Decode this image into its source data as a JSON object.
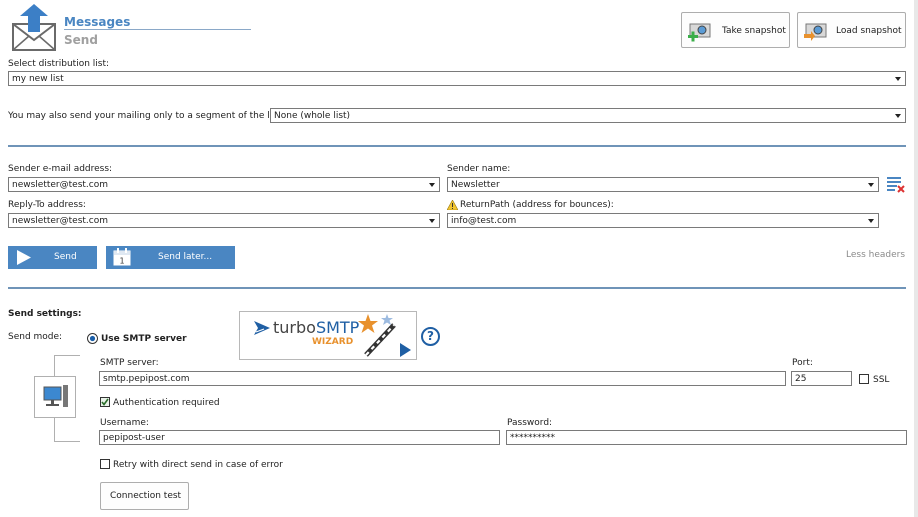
{
  "header": {
    "title": "Messages",
    "subtitle": "Send"
  },
  "toolbar": {
    "take_snapshot": "Take snapshot",
    "load_snapshot": "Load snapshot"
  },
  "distribution": {
    "label": "Select distribution list:",
    "value": "my new list"
  },
  "segment": {
    "label": "You may also send your mailing only to a segment of the list:",
    "value": "None (whole list)"
  },
  "sender": {
    "email_label": "Sender e-mail address:",
    "email_value": "newsletter@test.com",
    "name_label": "Sender name:",
    "name_value": "Newsletter",
    "replyto_label": "Reply-To address:",
    "replyto_value": "newsletter@test.com",
    "return_label": "ReturnPath (address for bounces):",
    "return_value": "info@test.com"
  },
  "actions": {
    "send": "Send",
    "send_later": "Send later...",
    "calendar_day": "1",
    "less_headers": "Less headers"
  },
  "settings": {
    "title": "Send settings:",
    "mode_label": "Send mode:",
    "mode_option": "Use SMTP server",
    "smtp_label": "SMTP server:",
    "smtp_value": "smtp.pepipost.com",
    "port_label": "Port:",
    "port_value": "25",
    "ssl_label": "SSL",
    "auth_label": "Authentication required",
    "username_label": "Username:",
    "username_value": "pepipost-user",
    "password_label": "Password:",
    "password_value": "**********",
    "retry_label": "Retry with direct send in case of error",
    "connection_test": "Connection test"
  },
  "wizard": {
    "brand_a": "turbo",
    "brand_b": "SMTP",
    "sub": "WIZARD"
  },
  "help": {
    "glyph": "?"
  },
  "colors": {
    "accent": "#4a86c2",
    "separator": "#6f94b8",
    "wizard_orange": "#e8912d"
  }
}
